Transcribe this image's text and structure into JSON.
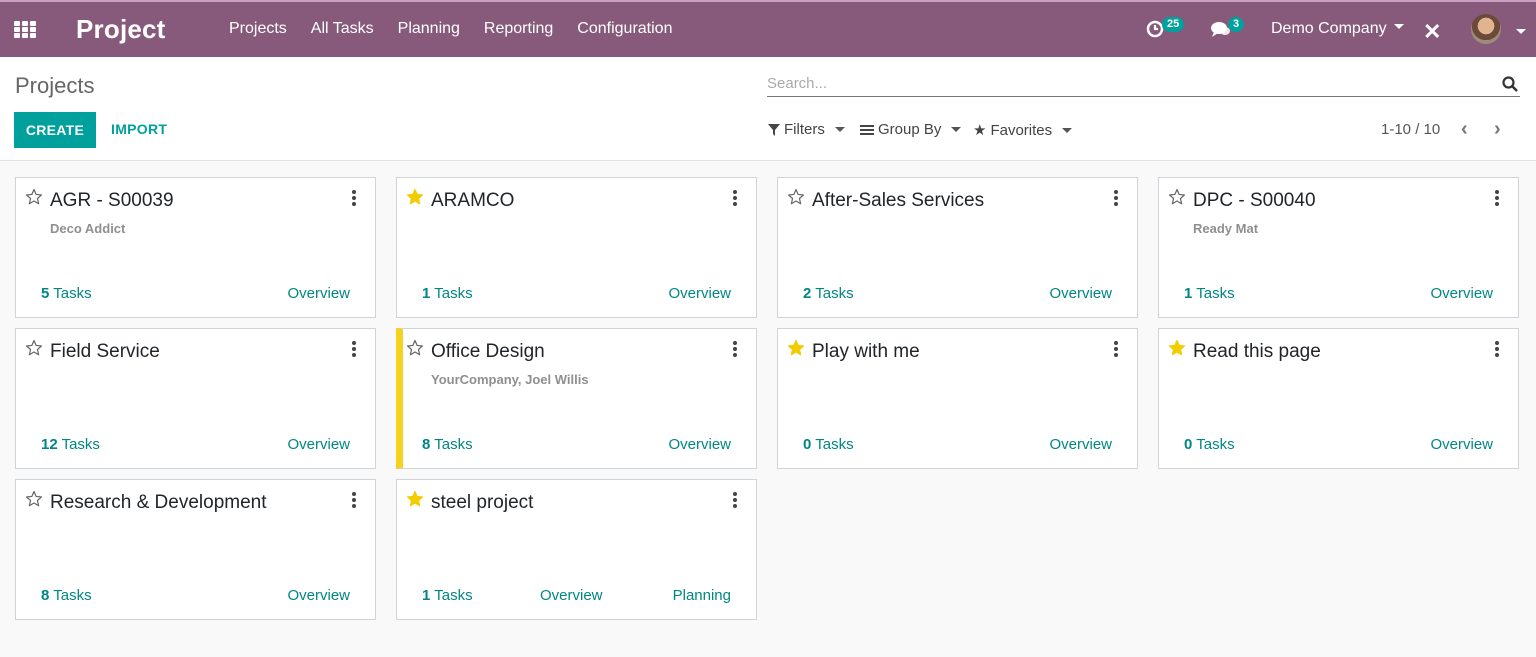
{
  "navbar": {
    "app_title": "Project",
    "menu": [
      "Projects",
      "All Tasks",
      "Planning",
      "Reporting",
      "Configuration"
    ],
    "activity_count": "25",
    "message_count": "3",
    "company": "Demo Company",
    "bg_color": "#875a7b"
  },
  "control": {
    "breadcrumb": "Projects",
    "search_placeholder": "Search...",
    "create_label": "CREATE",
    "import_label": "IMPORT",
    "filters_label": "Filters",
    "groupby_label": "Group By",
    "favorites_label": "Favorites",
    "pager": "1-10 / 10"
  },
  "cards": [
    {
      "title": "AGR - S00039",
      "subtitle": "Deco Addict",
      "favorite": false,
      "tasks_count": "5",
      "tasks_label": "Tasks",
      "overview": "Overview"
    },
    {
      "title": "ARAMCO",
      "subtitle": "",
      "favorite": true,
      "tasks_count": "1",
      "tasks_label": "Tasks",
      "overview": "Overview"
    },
    {
      "title": "After-Sales Services",
      "subtitle": "",
      "favorite": false,
      "tasks_count": "2",
      "tasks_label": "Tasks",
      "overview": "Overview"
    },
    {
      "title": "DPC - S00040",
      "subtitle": "Ready Mat",
      "favorite": false,
      "tasks_count": "1",
      "tasks_label": "Tasks",
      "overview": "Overview"
    },
    {
      "title": "Field Service",
      "subtitle": "",
      "favorite": false,
      "tasks_count": "12",
      "tasks_label": "Tasks",
      "overview": "Overview"
    },
    {
      "title": "Office Design",
      "subtitle": "YourCompany, Joel Willis",
      "favorite": false,
      "tasks_count": "8",
      "tasks_label": "Tasks",
      "overview": "Overview",
      "color": "#f4d21f"
    },
    {
      "title": "Play with me",
      "subtitle": "",
      "favorite": true,
      "tasks_count": "0",
      "tasks_label": "Tasks",
      "overview": "Overview"
    },
    {
      "title": "Read this page",
      "subtitle": "",
      "favorite": true,
      "tasks_count": "0",
      "tasks_label": "Tasks",
      "overview": "Overview"
    },
    {
      "title": "Research & Development",
      "subtitle": "",
      "favorite": false,
      "tasks_count": "8",
      "tasks_label": "Tasks",
      "overview": "Overview"
    },
    {
      "title": "steel project",
      "subtitle": "",
      "favorite": true,
      "tasks_count": "1",
      "tasks_label": "Tasks",
      "overview": "Overview",
      "planning": "Planning"
    }
  ],
  "colors": {
    "accent": "#00a09d",
    "link": "#008784",
    "star": "#f3cc00"
  }
}
